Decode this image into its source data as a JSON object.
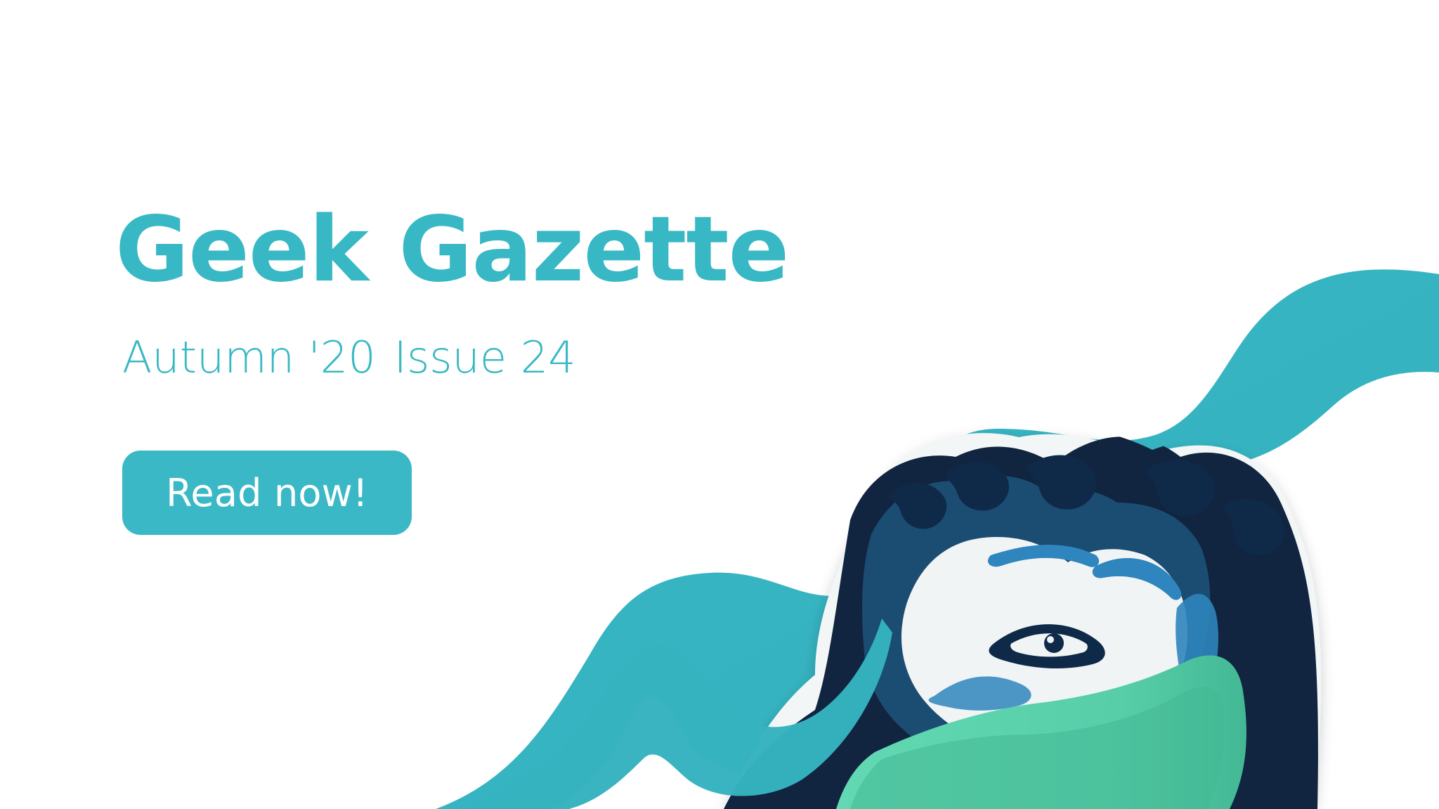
{
  "banner": {
    "title": "Geek Gazette",
    "season": "Autumn '20",
    "issue": "Issue 24",
    "cta_label": "Read now!"
  },
  "art": {
    "subject": "statue-face-with-mask-illustration",
    "colors": {
      "wave": "#3ab8c6",
      "wave_shadow": "#2a9aa8",
      "hair_dark": "#112440",
      "hair_blue": "#1c4f74",
      "face_blue": "#2f85bd",
      "face_light": "#f1f4f5",
      "mask_green": "#5fd4af",
      "mask_green_dark": "#3fb38f"
    }
  }
}
